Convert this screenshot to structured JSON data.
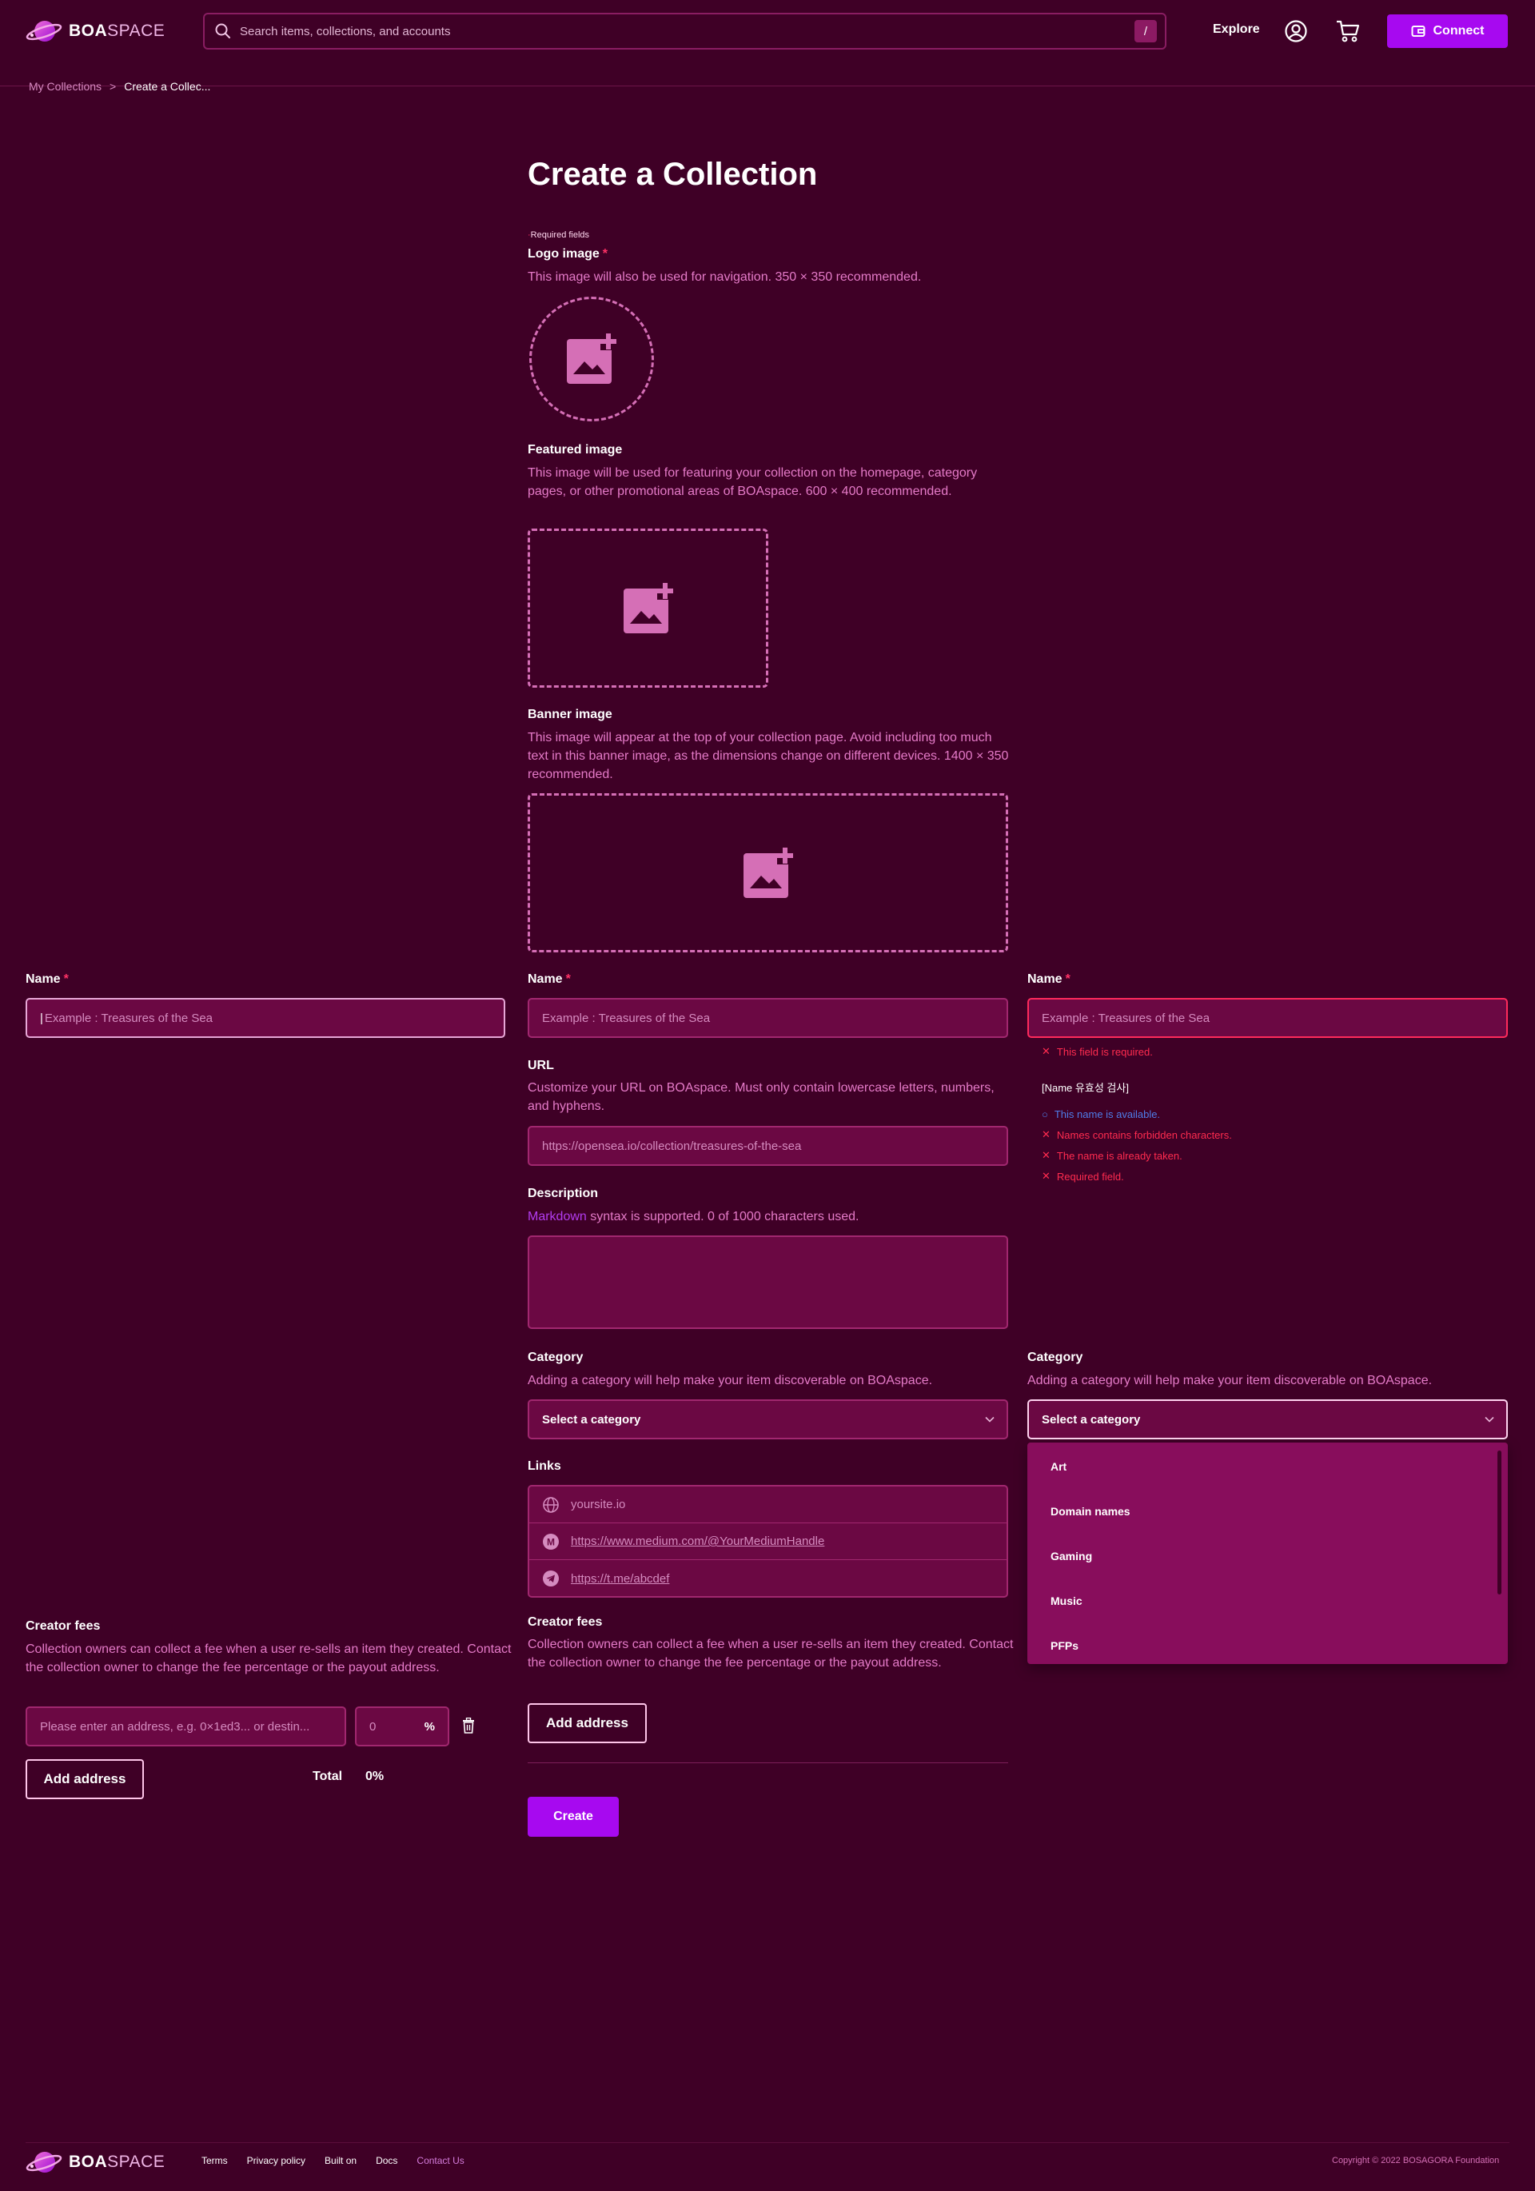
{
  "header": {
    "logo_bold": "BOA",
    "logo_light": "SPACE",
    "search_placeholder": "Search items, collections, and accounts",
    "search_shortcut": "/",
    "explore": "Explore",
    "connect": "Connect"
  },
  "breadcrumb": {
    "parent": "My Collections",
    "separator": ">",
    "current": "Create a Collec..."
  },
  "page": {
    "title": "Create a Collection",
    "required_note": "Required fields"
  },
  "logo_image": {
    "label": "Logo image",
    "star": "*",
    "description": "This image will also be used for navigation. 350 × 350 recommended."
  },
  "featured_image": {
    "label": "Featured image",
    "description": "This image will be used for featuring your collection on the homepage, category pages, or other promotional areas of BOAspace. 600 × 400 recommended."
  },
  "banner_image": {
    "label": "Banner image",
    "description": "This image will appear at the top of your collection page. Avoid including too much text in this banner image, as the dimensions change on different devices. 1400 × 350 recommended."
  },
  "name_field": {
    "label": "Name",
    "star": "*",
    "placeholder": "Example : Treasures of the Sea",
    "error": "This field is required.",
    "validation_title": "[Name 유효성 검사]",
    "validation": [
      {
        "status": "ok",
        "text": "This name is available."
      },
      {
        "status": "error",
        "text": "Names contains forbidden characters."
      },
      {
        "status": "error",
        "text": "The name is already taken."
      },
      {
        "status": "error",
        "text": "Required field."
      }
    ]
  },
  "url_field": {
    "label": "URL",
    "description": "Customize your URL on BOAspace. Must only contain lowercase letters, numbers, and hyphens.",
    "placeholder": "https://opensea.io/collection/treasures-of-the-sea"
  },
  "description_field": {
    "label": "Description",
    "link": "Markdown",
    "description_rest": " syntax is supported. 0 of 1000 characters used."
  },
  "category_field": {
    "label": "Category",
    "description": "Adding a category will help make your item discoverable on BOAspace.",
    "placeholder": "Select a category",
    "options": [
      "Art",
      "Domain names",
      "Gaming",
      "Music",
      "PFPs"
    ]
  },
  "links_field": {
    "label": "Links",
    "website": "yoursite.io",
    "medium": "https://www.medium.com/@YourMediumHandle",
    "telegram": "https://t.me/abcdef"
  },
  "creator_fees": {
    "label": "Creator fees",
    "description": "Collection owners can collect a fee when a user re-sells an item they created. Contact the collection owner to change the fee percentage or the payout address.",
    "address_placeholder": "Please enter an address, e.g. 0×1ed3... or destin...",
    "percent_placeholder": "0",
    "percent_sign": "%",
    "add_address": "Add address",
    "total_label": "Total",
    "total_value": "0%"
  },
  "create_button": "Create",
  "footer": {
    "logo_bold": "BOA",
    "logo_light": "SPACE",
    "links": [
      "Terms",
      "Privacy policy",
      "Built on",
      "Docs"
    ],
    "contact": "Contact Us",
    "copyright": "Copyright © 2022 BOSAGORA Foundation"
  },
  "colors": {
    "background": "#3f0026",
    "input_bg": "#6b0843",
    "accent_purple": "#a709f0",
    "text_pink": "#e57ac8",
    "error_red": "#ff2b4f",
    "ok_blue": "#4e7ce8",
    "dropdown_bg": "#880d5c"
  }
}
